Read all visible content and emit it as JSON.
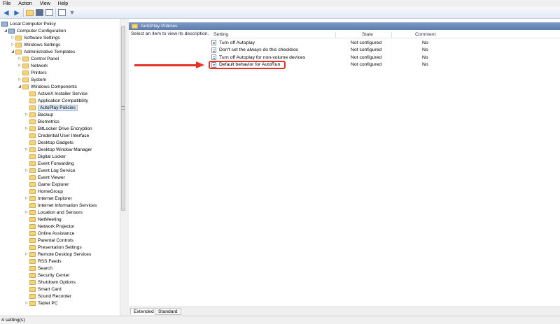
{
  "menu": [
    "File",
    "Action",
    "View",
    "Help"
  ],
  "toolbar_icons": [
    "back-arrow-icon",
    "forward-arrow-icon",
    "up-folder-icon",
    "show-hide-tree-icon",
    "export-list-icon",
    "help-icon",
    "filter-icon"
  ],
  "tree": {
    "root": "Local Computer Policy",
    "computer_configuration": "Computer Configuration",
    "items": [
      {
        "label": "Software Settings",
        "level": 2,
        "expander": "collapsed"
      },
      {
        "label": "Windows Settings",
        "level": 2,
        "expander": "collapsed"
      },
      {
        "label": "Administrative Templates",
        "level": 2,
        "expander": "expanded"
      },
      {
        "label": "Control Panel",
        "level": 3,
        "expander": "collapsed"
      },
      {
        "label": "Network",
        "level": 3,
        "expander": "collapsed"
      },
      {
        "label": "Printers",
        "level": 3,
        "expander": "none"
      },
      {
        "label": "System",
        "level": 3,
        "expander": "collapsed"
      },
      {
        "label": "Windows Components",
        "level": 3,
        "expander": "expanded"
      },
      {
        "label": "ActiveX Installer Service",
        "level": 4,
        "expander": "none"
      },
      {
        "label": "Application Compatibility",
        "level": 4,
        "expander": "none"
      },
      {
        "label": "AutoPlay Policies",
        "level": 4,
        "expander": "none",
        "selected": true
      },
      {
        "label": "Backup",
        "level": 4,
        "expander": "collapsed"
      },
      {
        "label": "Biometrics",
        "level": 4,
        "expander": "none"
      },
      {
        "label": "BitLocker Drive Encryption",
        "level": 4,
        "expander": "collapsed"
      },
      {
        "label": "Credential User Interface",
        "level": 4,
        "expander": "none"
      },
      {
        "label": "Desktop Gadgets",
        "level": 4,
        "expander": "none"
      },
      {
        "label": "Desktop Window Manager",
        "level": 4,
        "expander": "collapsed"
      },
      {
        "label": "Digital Locker",
        "level": 4,
        "expander": "none"
      },
      {
        "label": "Event Forwarding",
        "level": 4,
        "expander": "none"
      },
      {
        "label": "Event Log Service",
        "level": 4,
        "expander": "collapsed"
      },
      {
        "label": "Event Viewer",
        "level": 4,
        "expander": "none"
      },
      {
        "label": "Game Explorer",
        "level": 4,
        "expander": "none"
      },
      {
        "label": "HomeGroup",
        "level": 4,
        "expander": "none"
      },
      {
        "label": "Internet Explorer",
        "level": 4,
        "expander": "collapsed"
      },
      {
        "label": "Internet Information Services",
        "level": 4,
        "expander": "none"
      },
      {
        "label": "Location and Sensors",
        "level": 4,
        "expander": "collapsed"
      },
      {
        "label": "NetMeeting",
        "level": 4,
        "expander": "none"
      },
      {
        "label": "Network Projector",
        "level": 4,
        "expander": "none"
      },
      {
        "label": "Online Assistance",
        "level": 4,
        "expander": "none"
      },
      {
        "label": "Parental Controls",
        "level": 4,
        "expander": "none"
      },
      {
        "label": "Presentation Settings",
        "level": 4,
        "expander": "none"
      },
      {
        "label": "Remote Desktop Services",
        "level": 4,
        "expander": "collapsed"
      },
      {
        "label": "RSS Feeds",
        "level": 4,
        "expander": "none"
      },
      {
        "label": "Search",
        "level": 4,
        "expander": "none"
      },
      {
        "label": "Security Center",
        "level": 4,
        "expander": "none"
      },
      {
        "label": "Shutdown Options",
        "level": 4,
        "expander": "none"
      },
      {
        "label": "Smart Card",
        "level": 4,
        "expander": "none"
      },
      {
        "label": "Sound Recorder",
        "level": 4,
        "expander": "none"
      },
      {
        "label": "Tablet PC",
        "level": 4,
        "expander": "collapsed"
      }
    ]
  },
  "right_pane": {
    "header_title": "AutoPlay Policies",
    "description": "Select an item to view its description.",
    "columns": {
      "setting": "Setting",
      "state": "State",
      "comment": "Comment"
    },
    "rows": [
      {
        "setting": "Turn off Autoplay",
        "state": "Not configured",
        "comment": "No"
      },
      {
        "setting": "Don't set the always do this checkbox",
        "state": "Not configured",
        "comment": "No"
      },
      {
        "setting": "Turn off Autoplay for non-volume devices",
        "state": "Not configured",
        "comment": "No"
      },
      {
        "setting": "Default behavior for AutoRun",
        "state": "Not configured",
        "comment": "No",
        "highlighted": true
      }
    ]
  },
  "tabs": [
    "Extended",
    "Standard"
  ],
  "active_tab": "Extended",
  "status_text": "4 setting(s)",
  "annotation_color": "#e53224"
}
